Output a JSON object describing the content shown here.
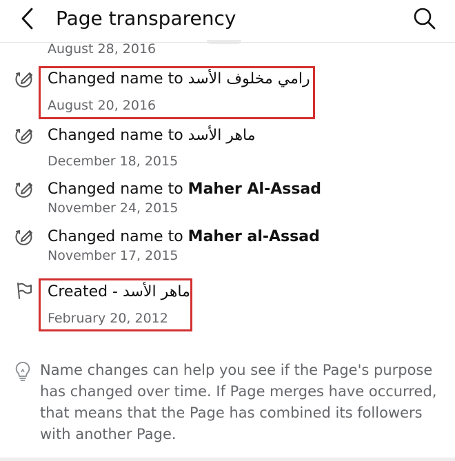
{
  "header": {
    "title": "Page transparency",
    "back_icon": "chevron-left-icon",
    "search_icon": "search-icon"
  },
  "history": [
    {
      "prefix": "",
      "name": "",
      "date": "August 28, 2016",
      "icon": "edit-icon"
    },
    {
      "prefix": "Changed name to",
      "name": "رامي مخلوف الأسد",
      "date": "August 20, 2016",
      "icon": "edit-icon",
      "highlighted": true
    },
    {
      "prefix": "Changed name to",
      "name": "ماهر الأسد",
      "date": "December 18, 2015",
      "icon": "edit-icon"
    },
    {
      "prefix": "Changed name to",
      "name": "Maher Al-Assad",
      "date": "November 24, 2015",
      "icon": "edit-icon"
    },
    {
      "prefix": "Changed name to",
      "name": "Maher al-Assad",
      "date": "November 17, 2015",
      "icon": "edit-icon"
    },
    {
      "prefix": "Created -",
      "name": "ماهر الأسد",
      "date": "February 20, 2012",
      "icon": "flag-icon",
      "highlighted": true
    }
  ],
  "info": {
    "icon": "lightbulb-icon",
    "text": "Name changes can help you see if the Page's purpose has changed over time. If Page merges have occurred, that means that the Page has combined its followers with another Page."
  },
  "colors": {
    "highlight": "#d32f2f",
    "secondary_text": "#65676b",
    "primary_text": "#111111"
  }
}
